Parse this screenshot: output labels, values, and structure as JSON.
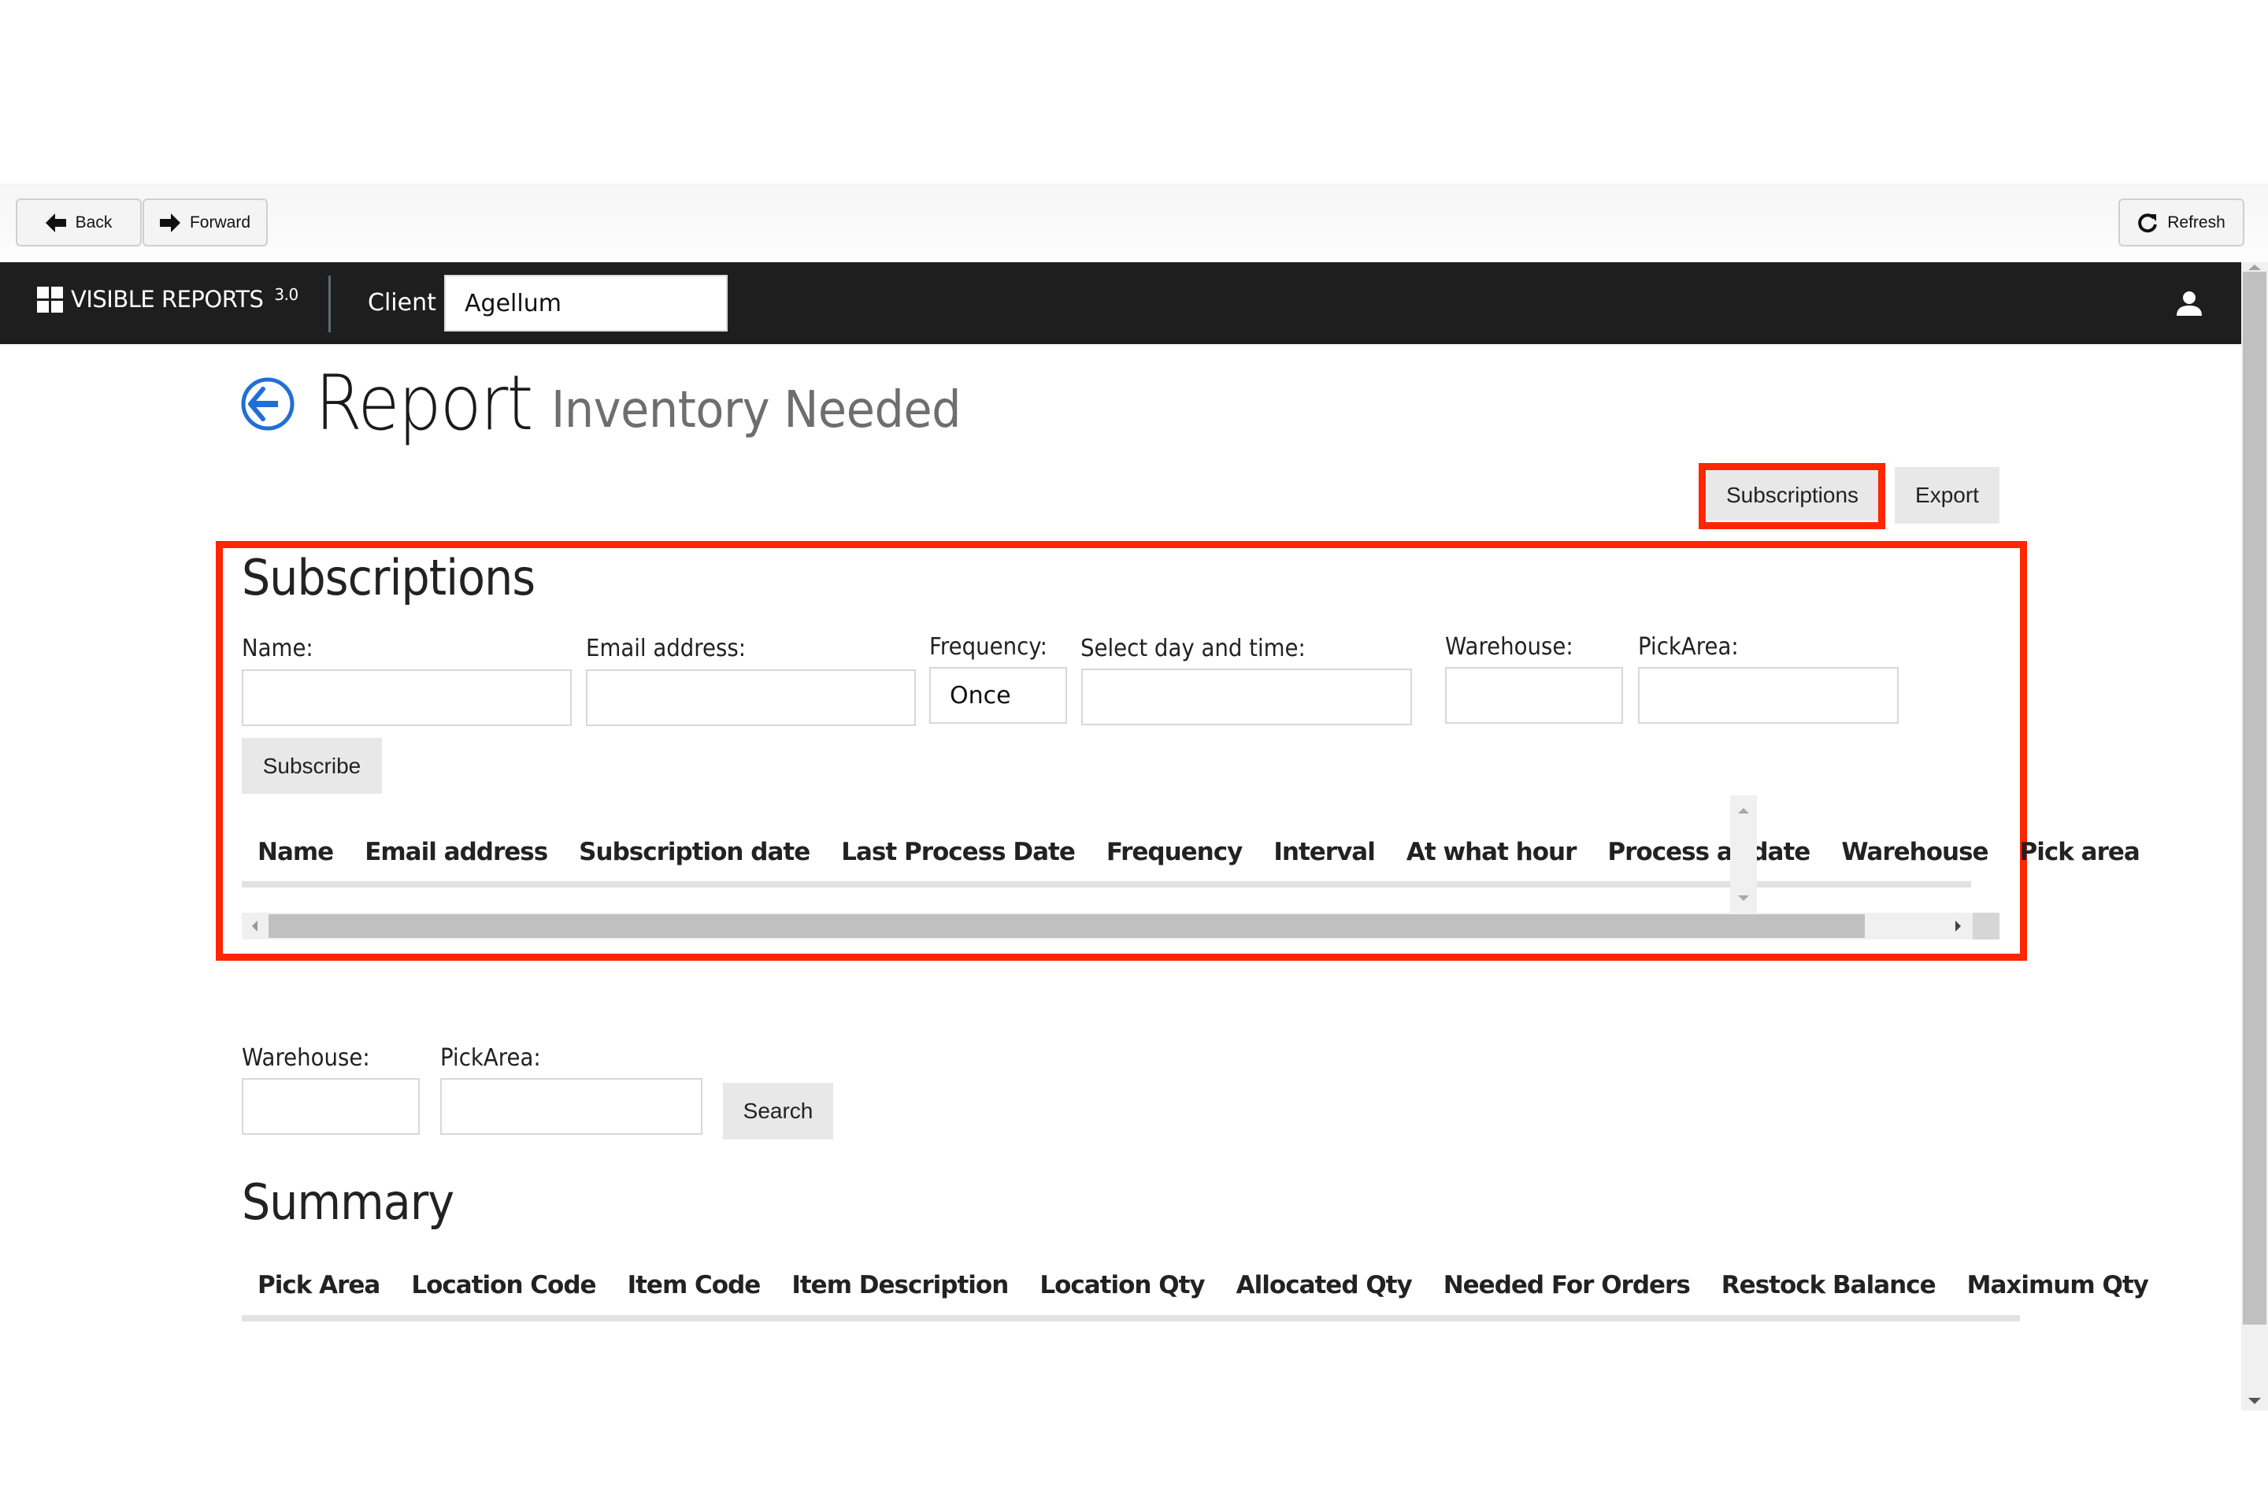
{
  "toolbar": {
    "back_label": "Back",
    "forward_label": "Forward",
    "refresh_label": "Refresh"
  },
  "navbar": {
    "brand": "VISIBLE REPORTS",
    "version": "3.0",
    "client_label": "Client",
    "client_value": "Agellum",
    "user_icon": "user-icon"
  },
  "header": {
    "title": "Report",
    "subtitle": "Inventory Needed",
    "subscriptions_button": "Subscriptions",
    "export_button": "Export"
  },
  "subscriptions": {
    "title": "Subscriptions",
    "fields": {
      "name_label": "Name:",
      "name_value": "",
      "email_label": "Email address:",
      "email_value": "",
      "frequency_label": "Frequency:",
      "frequency_value": "Once",
      "daytime_label": "Select day and time:",
      "daytime_value": "",
      "warehouse_label": "Warehouse:",
      "warehouse_value": "",
      "pickarea_label": "PickArea:",
      "pickarea_value": ""
    },
    "subscribe_button": "Subscribe",
    "columns": [
      "Name",
      "Email address",
      "Subscription date",
      "Last Process Date",
      "Frequency",
      "Interval",
      "At what hour",
      "Process at date",
      "Warehouse",
      "Pick area"
    ],
    "rows": []
  },
  "filters": {
    "warehouse_label": "Warehouse:",
    "warehouse_value": "",
    "pickarea_label": "PickArea:",
    "pickarea_value": "",
    "search_button": "Search"
  },
  "summary": {
    "title": "Summary",
    "columns": [
      "Pick Area",
      "Location Code",
      "Item Code",
      "Item Description",
      "Location Qty",
      "Allocated Qty",
      "Needed For Orders",
      "Restock Balance",
      "Maximum Qty"
    ],
    "rows": []
  },
  "colors": {
    "highlight": "#ff2600",
    "navbar": "#1e1e1e",
    "accent": "#1f6fd6"
  }
}
